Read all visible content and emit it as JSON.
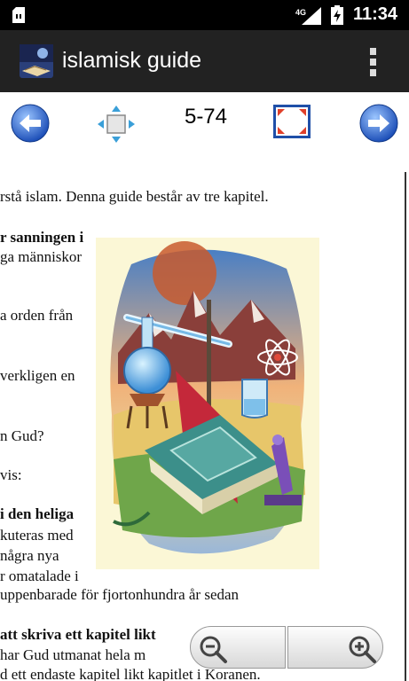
{
  "status_bar": {
    "network": "4G",
    "time": "11:34"
  },
  "app_bar": {
    "title": "islamisk guide"
  },
  "toolbar": {
    "page_indicator": "5-74"
  },
  "document": {
    "lines": [
      "rstå islam. Denna guide består av tre kapitel.",
      "r sanningen i",
      "ga människor",
      "a  orden  från",
      "verkligen  en",
      "n Gud?",
      "vis:",
      "i den heliga",
      "kuteras  med",
      "några    nya",
      "r omatalade i",
      "uppenbarade för fjortonhundra år sedan",
      "att skriva ett kapitel likt",
      "har Gud utmanat hela m",
      "d ett endaste kapitel likt kapitlet i Koranen."
    ]
  },
  "colors": {
    "status_bar_bg": "#000000",
    "app_bar_bg": "#222222",
    "accent_line": "#3a9fd8",
    "nav_button": "#2f6fd6"
  },
  "icons": {
    "back": "arrow-left-icon",
    "next": "arrow-right-icon",
    "move": "move-arrows-icon",
    "fit": "fit-screen-icon",
    "zoom_out": "zoom-out-icon",
    "zoom_in": "zoom-in-icon",
    "overflow": "overflow-menu-icon"
  }
}
